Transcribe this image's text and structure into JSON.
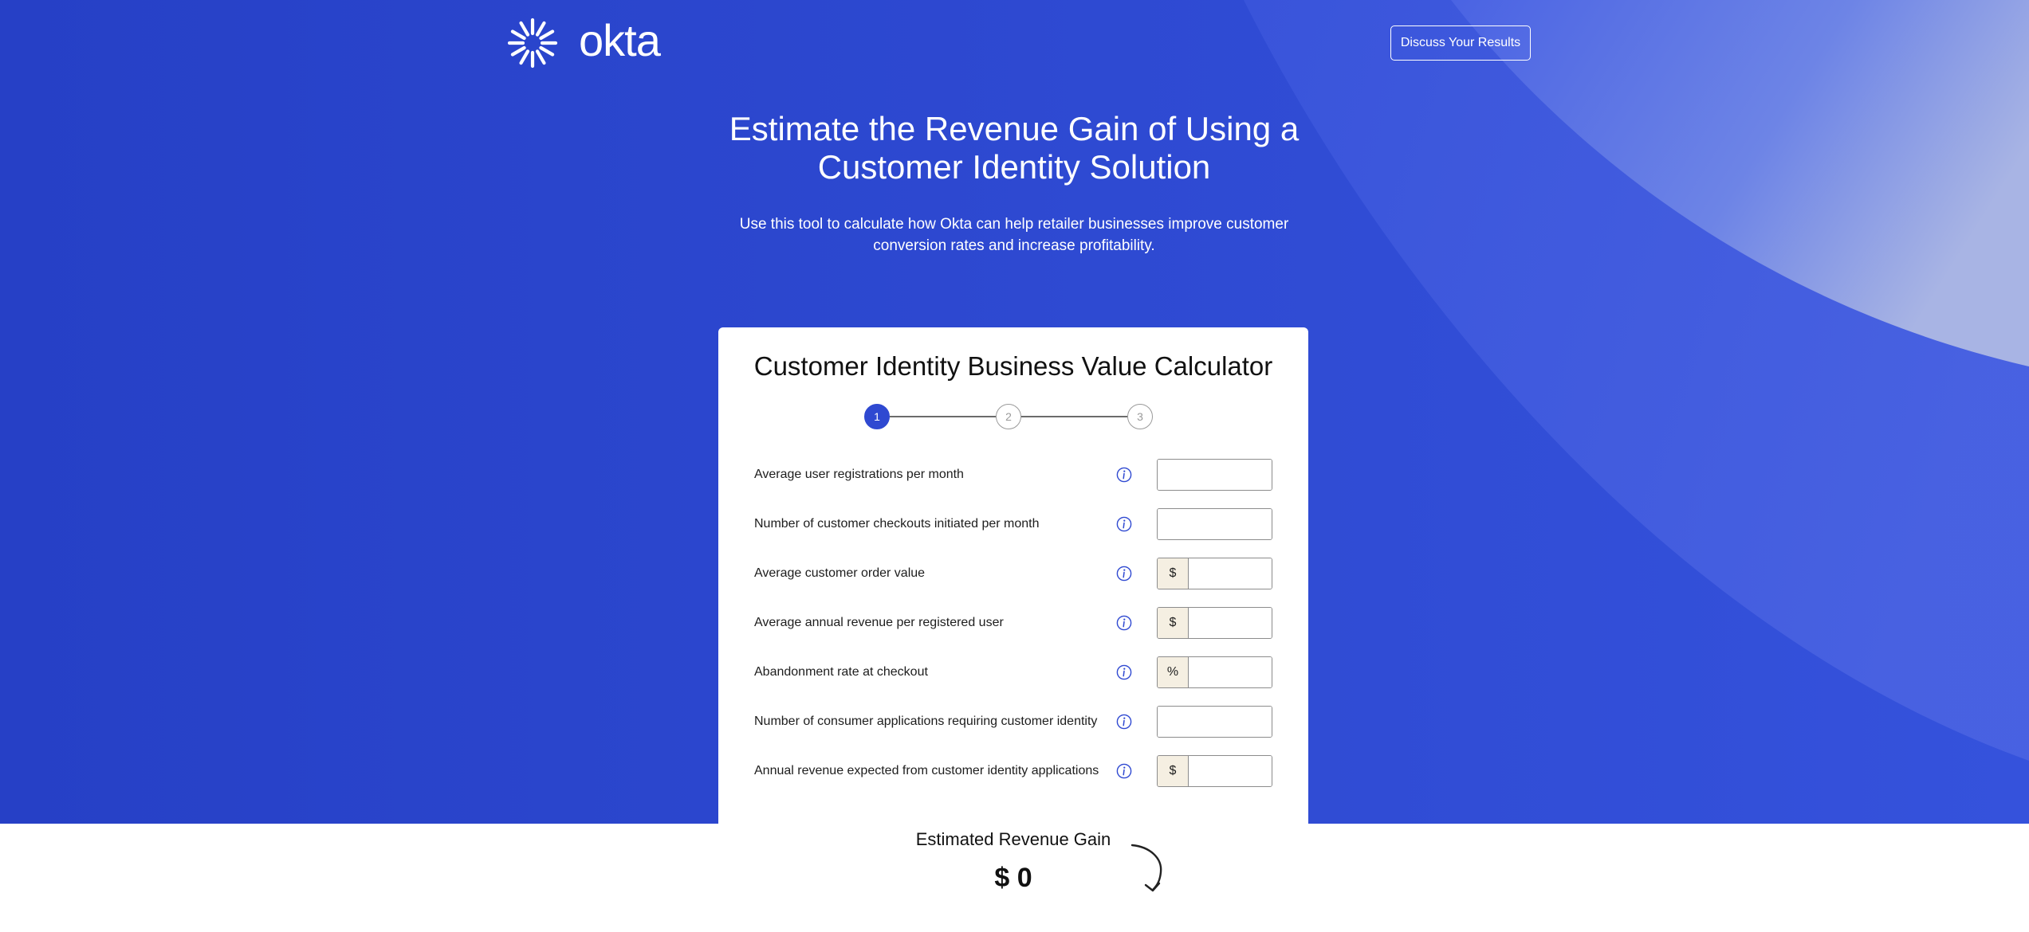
{
  "header": {
    "logo_text": "okta",
    "discuss_button": "Discuss Your Results"
  },
  "hero": {
    "title": "Estimate the Revenue Gain of Using a Customer Identity Solution",
    "subtitle": "Use this tool to calculate how Okta can help retailer businesses improve customer conversion rates and increase profitability."
  },
  "calculator": {
    "title": "Customer Identity Business Value Calculator",
    "steps": [
      "1",
      "2",
      "3"
    ],
    "active_step": 1,
    "fields": [
      {
        "label": "Average user registrations per month",
        "prefix": "",
        "value": ""
      },
      {
        "label": "Number of customer checkouts initiated per month",
        "prefix": "",
        "value": ""
      },
      {
        "label": "Average customer order value",
        "prefix": "$",
        "value": ""
      },
      {
        "label": "Average annual revenue per registered user",
        "prefix": "$",
        "value": ""
      },
      {
        "label": "Abandonment rate at checkout",
        "prefix": "%",
        "value": ""
      },
      {
        "label": "Number of consumer applications requiring customer identity",
        "prefix": "",
        "value": ""
      },
      {
        "label": "Annual revenue expected from customer identity applications",
        "prefix": "$",
        "value": ""
      }
    ],
    "result": {
      "label": "Estimated Revenue Gain",
      "value": "$ 0"
    }
  },
  "icons": {
    "info": "info-icon",
    "logo": "okta-sunburst-icon",
    "arrow": "curved-arrow-down-icon"
  },
  "colors": {
    "hero_blue": "#2640c6",
    "accent": "#2f49d1",
    "prefix_bg": "#f5efe2"
  }
}
